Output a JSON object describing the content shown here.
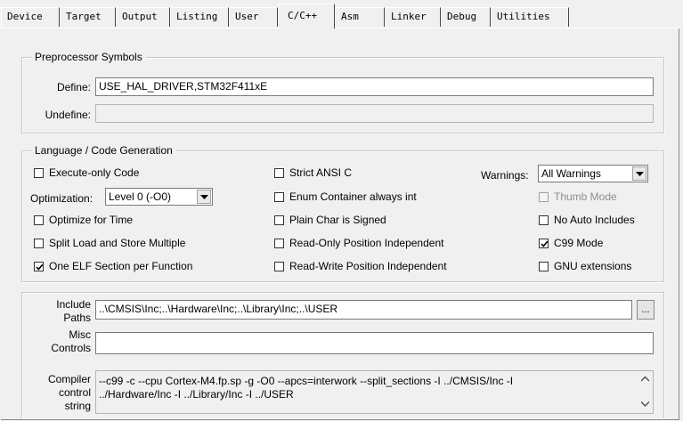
{
  "tabs": [
    {
      "label": "Device"
    },
    {
      "label": "Target"
    },
    {
      "label": "Output"
    },
    {
      "label": "Listing"
    },
    {
      "label": "User"
    },
    {
      "label": "C/C++"
    },
    {
      "label": "Asm"
    },
    {
      "label": "Linker"
    },
    {
      "label": "Debug"
    },
    {
      "label": "Utilities"
    }
  ],
  "preprocessor": {
    "title": "Preprocessor Symbols",
    "define_label": "Define:",
    "define_value": "USE_HAL_DRIVER,STM32F411xE",
    "undefine_label": "Undefine:",
    "undefine_value": ""
  },
  "language": {
    "title": "Language / Code Generation",
    "execute_only": {
      "label": "Execute-only Code",
      "checked": false
    },
    "optimization_label": "Optimization:",
    "optimization_value": "Level 0 (-O0)",
    "optimize_time": {
      "label": "Optimize for Time",
      "checked": false
    },
    "split_load": {
      "label": "Split Load and Store Multiple",
      "checked": false
    },
    "one_elf": {
      "label": "One ELF Section per Function",
      "checked": true
    },
    "strict_ansi": {
      "label": "Strict ANSI C",
      "checked": false
    },
    "enum_container": {
      "label": "Enum Container always int",
      "checked": false
    },
    "plain_char": {
      "label": "Plain Char is Signed",
      "checked": false
    },
    "ropi": {
      "label": "Read-Only Position Independent",
      "checked": false
    },
    "rwpi": {
      "label": "Read-Write Position Independent",
      "checked": false
    },
    "warnings_label": "Warnings:",
    "warnings_value": "All Warnings",
    "thumb_mode": {
      "label": "Thumb Mode",
      "checked": false
    },
    "no_auto_includes": {
      "label": "No Auto Includes",
      "checked": false
    },
    "c99_mode": {
      "label": "C99 Mode",
      "checked": true
    },
    "gnu_extensions": {
      "label": "GNU extensions",
      "checked": false
    }
  },
  "include": {
    "label_line1": "Include",
    "label_line2": "Paths",
    "value": "..\\CMSIS\\Inc;..\\Hardware\\Inc;..\\Library\\Inc;..\\USER",
    "browse_label": "..."
  },
  "misc": {
    "label_line1": "Misc",
    "label_line2": "Controls",
    "value": ""
  },
  "compiler": {
    "label_line1": "Compiler",
    "label_line2": "control",
    "label_line3": "string",
    "value_line1": "--c99 -c --cpu Cortex-M4.fp.sp -g -O0 --apcs=interwork --split_sections -I ../CMSIS/Inc -I",
    "value_line2": "../Hardware/Inc -I ../Library/Inc -I ../USER"
  },
  "colors": {
    "background": "#f0f0f0",
    "field": "#ffffff"
  }
}
